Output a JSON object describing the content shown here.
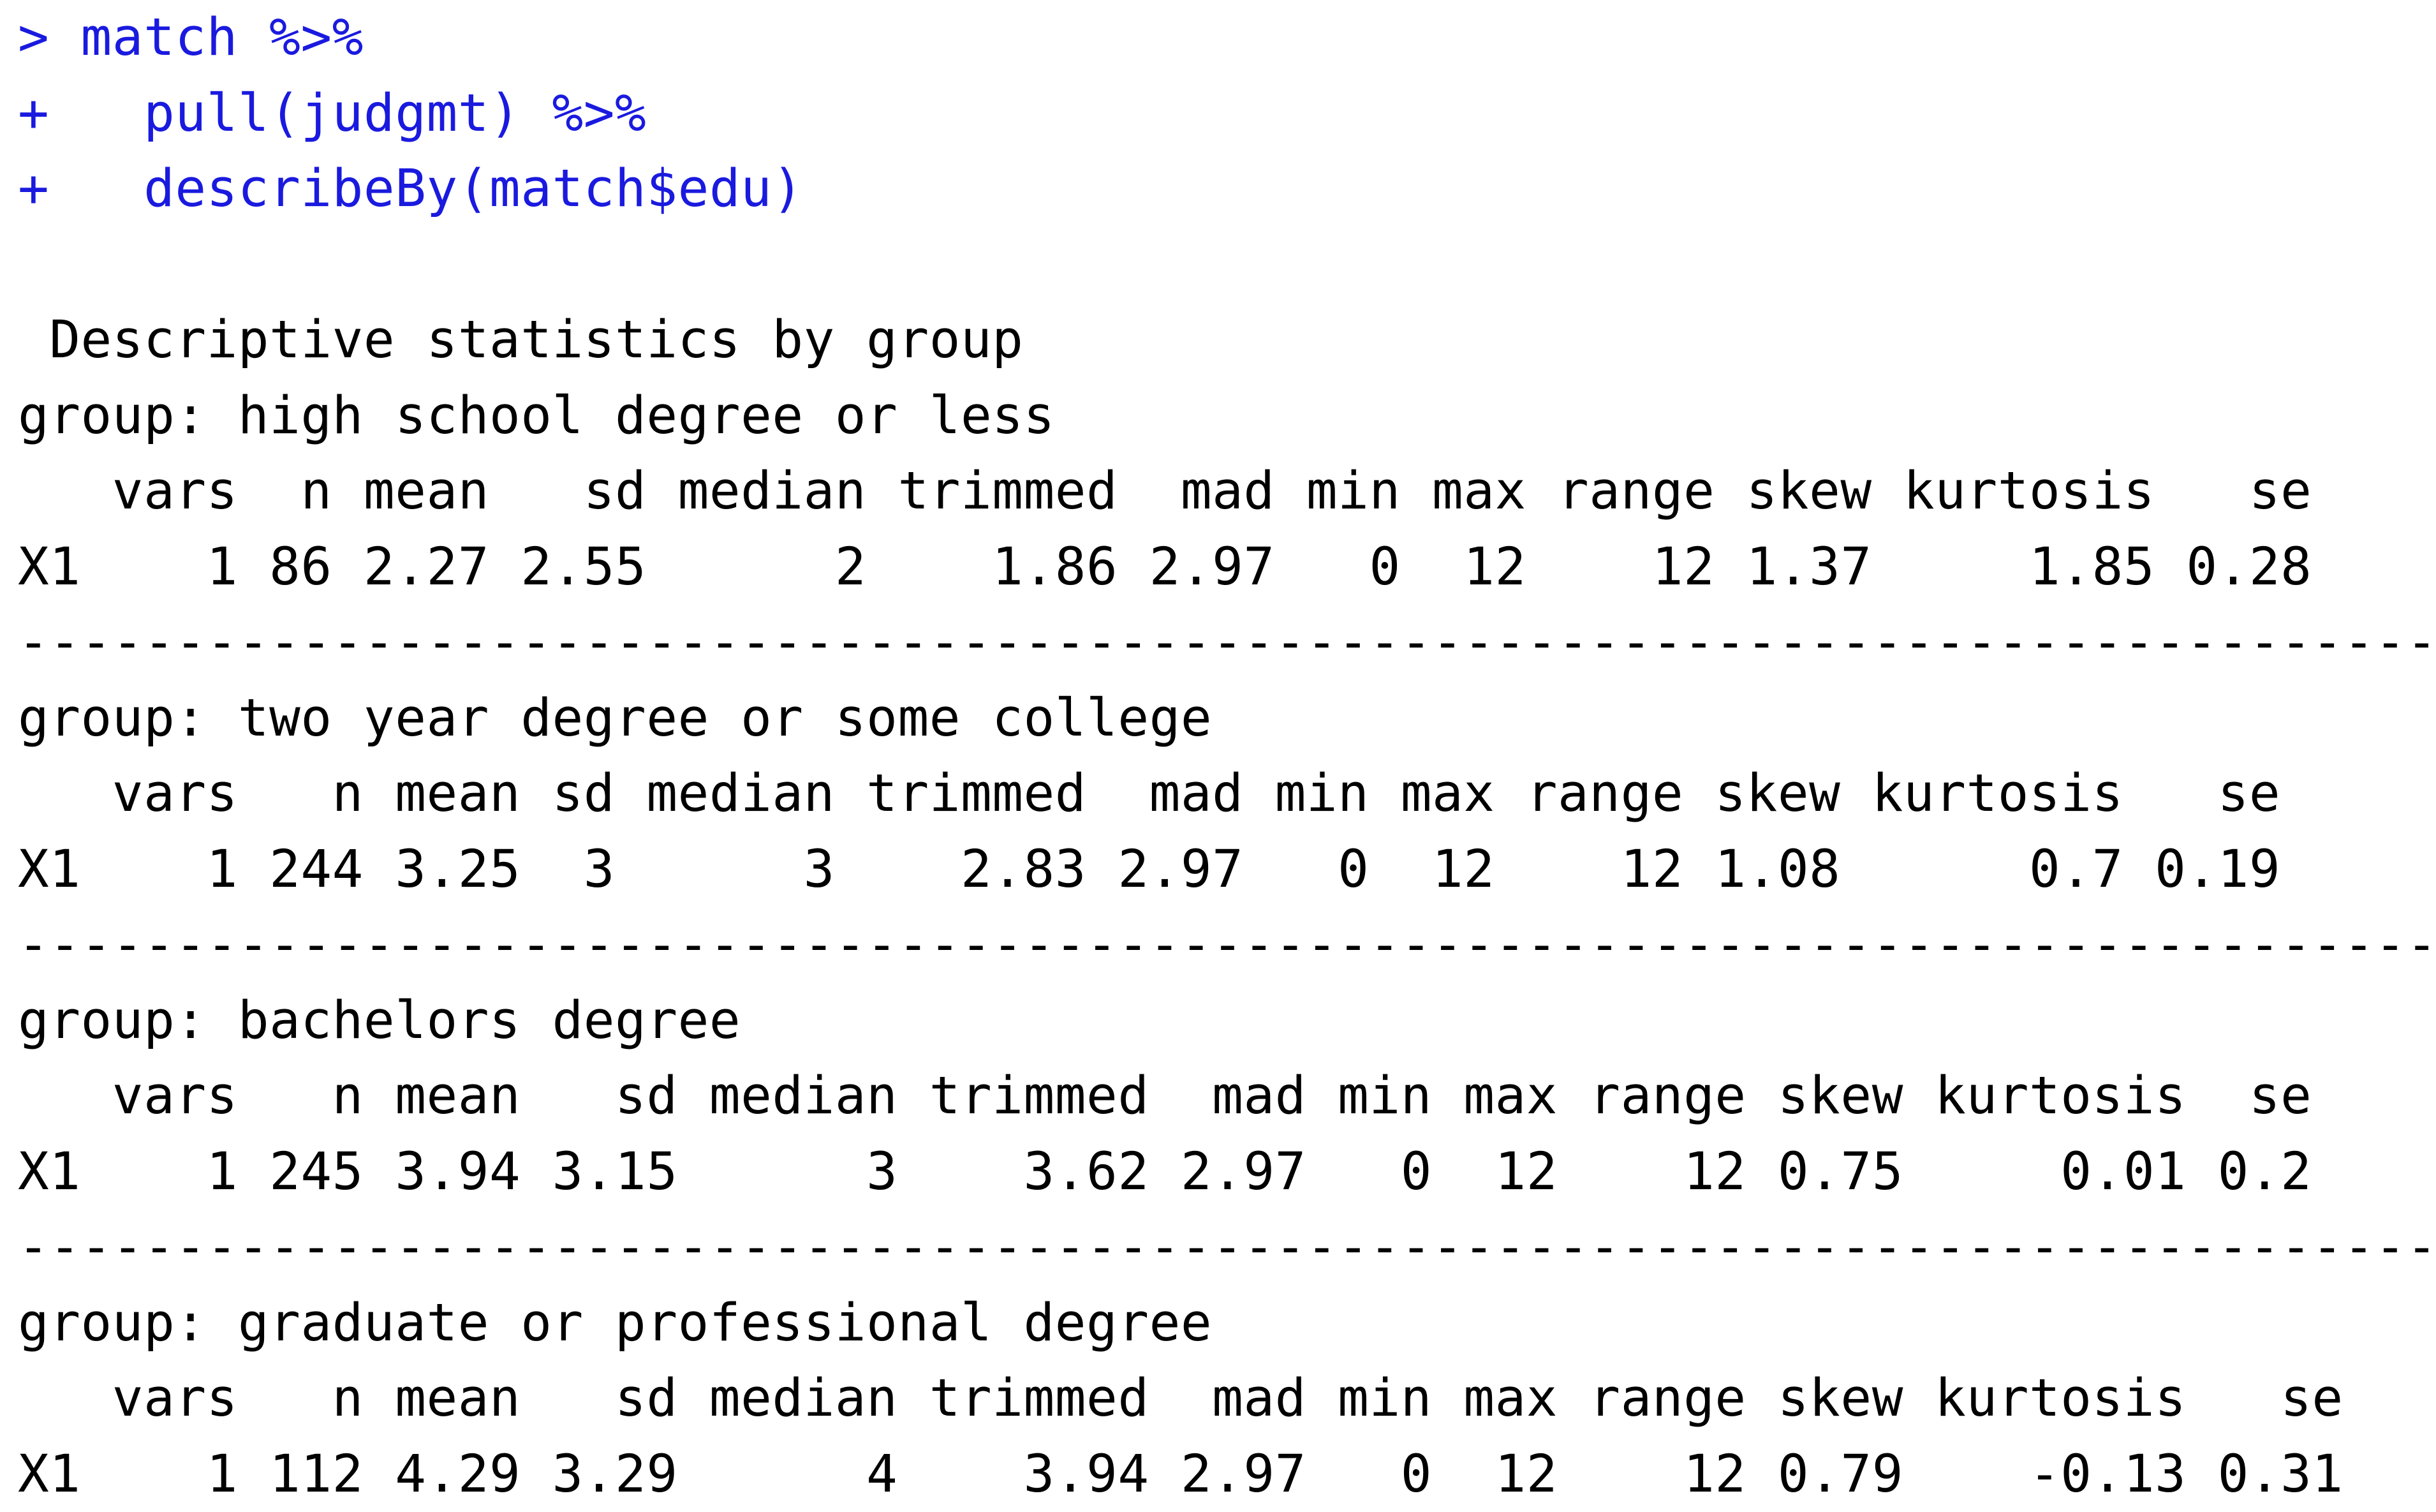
{
  "commands": [
    "> match %>%",
    "+   pull(judgmt) %>%",
    "+   describeBy(match$edu)"
  ],
  "title": " Descriptive statistics by group",
  "separator": "--------------------------------------------------------------------------------------------------------------------------------------------",
  "groups": [
    {
      "label": "group: high school degree or less",
      "header": "   vars  n mean   sd median trimmed  mad min max range skew kurtosis   se",
      "row": "X1    1 86 2.27 2.55      2    1.86 2.97   0  12    12 1.37     1.85 0.28",
      "values": {
        "vars": 1,
        "n": 86,
        "mean": 2.27,
        "sd": 2.55,
        "median": 2,
        "trimmed": 1.86,
        "mad": 2.97,
        "min": 0,
        "max": 12,
        "range": 12,
        "skew": 1.37,
        "kurtosis": 1.85,
        "se": 0.28
      }
    },
    {
      "label": "group: two year degree or some college",
      "header": "   vars   n mean sd median trimmed  mad min max range skew kurtosis   se",
      "row": "X1    1 244 3.25  3      3    2.83 2.97   0  12    12 1.08      0.7 0.19",
      "values": {
        "vars": 1,
        "n": 244,
        "mean": 3.25,
        "sd": 3,
        "median": 3,
        "trimmed": 2.83,
        "mad": 2.97,
        "min": 0,
        "max": 12,
        "range": 12,
        "skew": 1.08,
        "kurtosis": 0.7,
        "se": 0.19
      }
    },
    {
      "label": "group: bachelors degree",
      "header": "   vars   n mean   sd median trimmed  mad min max range skew kurtosis  se",
      "row": "X1    1 245 3.94 3.15      3    3.62 2.97   0  12    12 0.75     0.01 0.2",
      "values": {
        "vars": 1,
        "n": 245,
        "mean": 3.94,
        "sd": 3.15,
        "median": 3,
        "trimmed": 3.62,
        "mad": 2.97,
        "min": 0,
        "max": 12,
        "range": 12,
        "skew": 0.75,
        "kurtosis": 0.01,
        "se": 0.2
      }
    },
    {
      "label": "group: graduate or professional degree",
      "header": "   vars   n mean   sd median trimmed  mad min max range skew kurtosis   se",
      "row": "X1    1 112 4.29 3.29      4    3.94 2.97   0  12    12 0.79    -0.13 0.31",
      "values": {
        "vars": 1,
        "n": 112,
        "mean": 4.29,
        "sd": 3.29,
        "median": 4,
        "trimmed": 3.94,
        "mad": 2.97,
        "min": 0,
        "max": 12,
        "range": 12,
        "skew": 0.79,
        "kurtosis": -0.13,
        "se": 0.31
      }
    }
  ],
  "colors": {
    "command": "#1a1adf",
    "output": "#000000",
    "background": "#ffffff"
  }
}
